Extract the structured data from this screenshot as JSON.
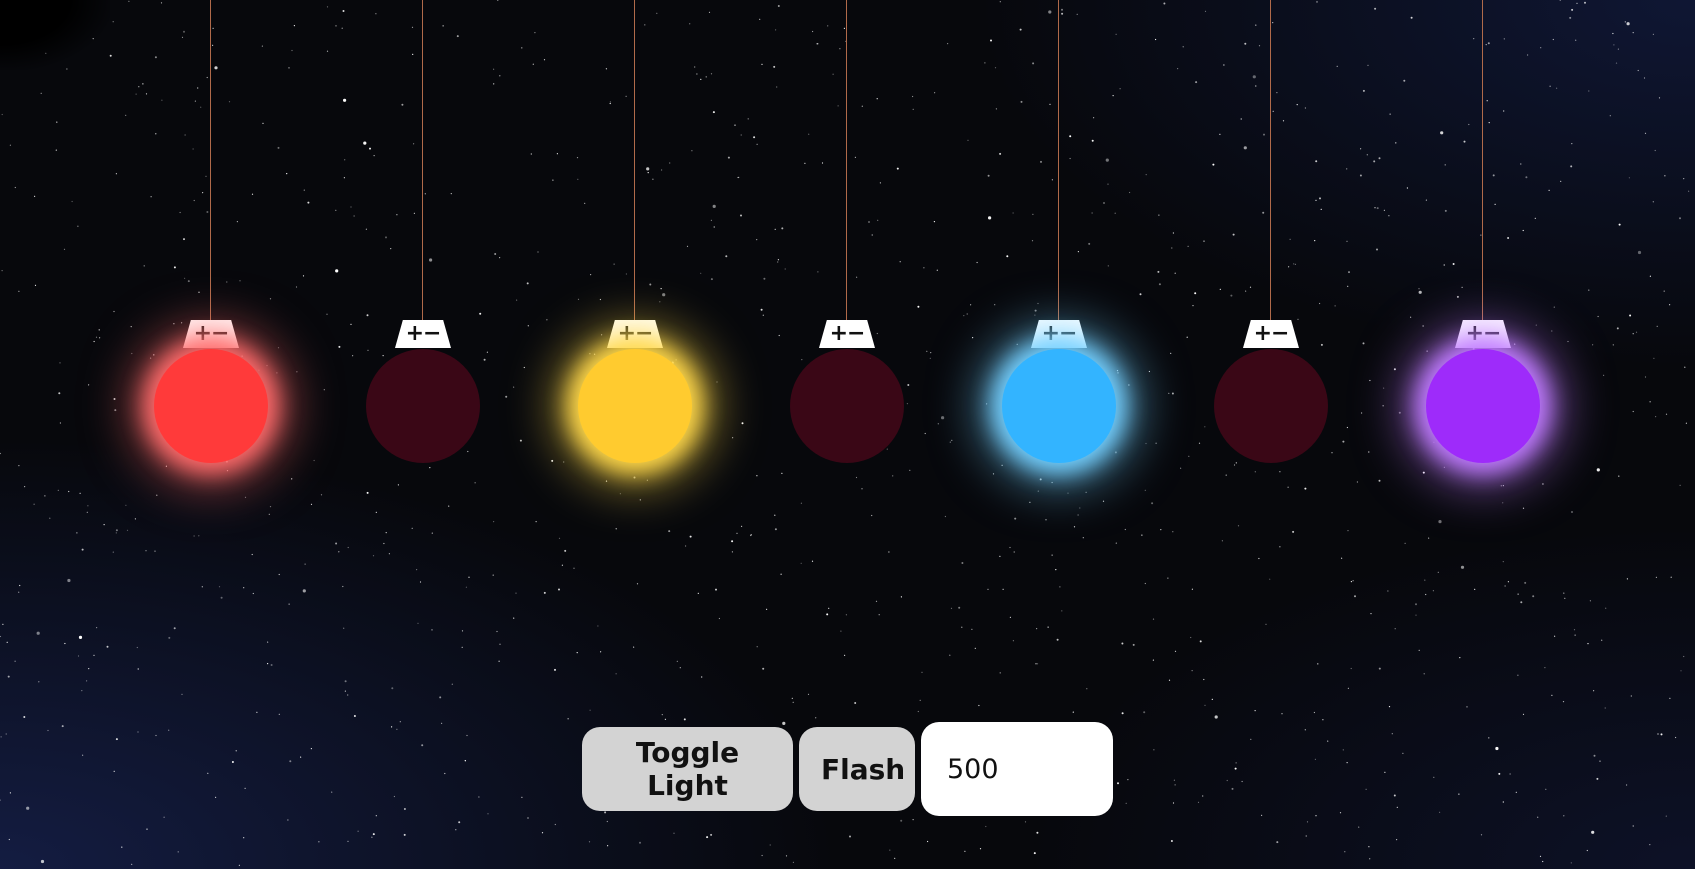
{
  "lights": [
    {
      "color": "#ff3a3a",
      "glow": "#ff6b6b",
      "on": true,
      "socket_label": "+−",
      "name": "red"
    },
    {
      "color": "#3a0716",
      "glow": "#3a0716",
      "on": false,
      "socket_label": "+−",
      "name": "red-off"
    },
    {
      "color": "#ffcb2f",
      "glow": "#ffd84a",
      "on": true,
      "socket_label": "+−",
      "name": "yellow"
    },
    {
      "color": "#3a0716",
      "glow": "#3a0716",
      "on": false,
      "socket_label": "+−",
      "name": "yellow-off"
    },
    {
      "color": "#33b4ff",
      "glow": "#74d0ff",
      "on": true,
      "socket_label": "+−",
      "name": "blue"
    },
    {
      "color": "#3a0716",
      "glow": "#3a0716",
      "on": false,
      "socket_label": "+−",
      "name": "blue-off"
    },
    {
      "color": "#9e2bfa",
      "glow": "#c07bff",
      "on": true,
      "socket_label": "+−",
      "name": "purple"
    }
  ],
  "controls": {
    "toggle_label": "Toggle Light",
    "flash_label": "Flash",
    "interval_value": "500"
  },
  "colors": {
    "background": "#07080c",
    "button_bg": "#d3d3d3",
    "wire": "#b06a4a"
  }
}
